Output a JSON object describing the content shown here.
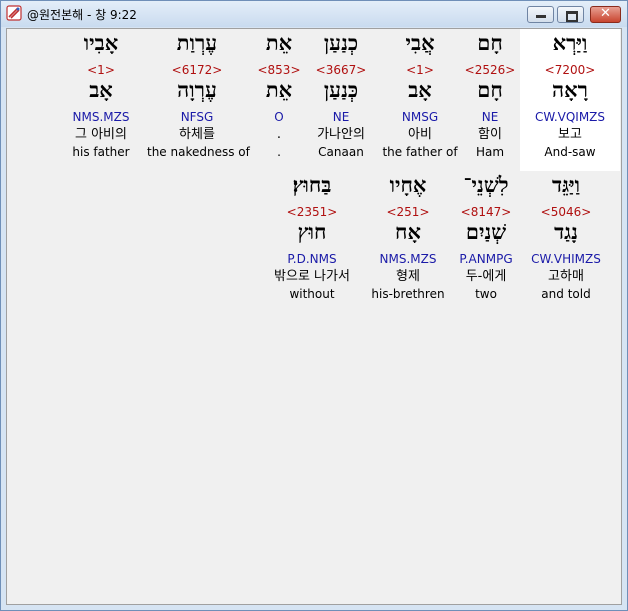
{
  "window": {
    "title": "@원전본해 - 창 9:22",
    "icon": "bible-app-icon",
    "controls": {
      "minimize": "minimize",
      "maximize": "maximize",
      "close": "✕"
    }
  },
  "colors": {
    "strong": "#b01010",
    "parse": "#1a1aa8",
    "highlight": "#ffffff"
  },
  "rows": [
    {
      "words": [
        {
          "heb": "וַיַּרְא",
          "strong": "<7200>",
          "lemma": "רָאָה",
          "parse": "CW.VQIMZS",
          "kor": "보고",
          "eng": "And-saw",
          "highlight": true
        },
        {
          "heb": "חָם",
          "strong": "<2526>",
          "lemma": "חָם",
          "parse": "NE",
          "kor": "함이",
          "eng": "Ham"
        },
        {
          "heb": "אֲבִי",
          "strong": "<1>",
          "lemma": "אָב",
          "parse": "NMSG",
          "kor": "아비",
          "eng": "the father of"
        },
        {
          "heb": "כְנַעַן",
          "strong": "<3667>",
          "lemma": "כְּנַעַן",
          "parse": "NE",
          "kor": "가나안의",
          "eng": "Canaan"
        },
        {
          "heb": "אֵת",
          "strong": "<853>",
          "lemma": "אֵת",
          "parse": "O",
          "kor": ".",
          "eng": "."
        },
        {
          "heb": "עֶרְוַת",
          "strong": "<6172>",
          "lemma": "עֶרְוָה",
          "parse": "NFSG",
          "kor": "하체를",
          "eng": "the nakedness of"
        },
        {
          "heb": "אָבִיו",
          "strong": "<1>",
          "lemma": "אָב",
          "parse": "NMS.MZS",
          "kor": "그 아비의",
          "eng": "his father"
        }
      ]
    },
    {
      "words": [
        {
          "heb": "וַיַּגֵּד",
          "strong": "<5046>",
          "lemma": "נָגַד",
          "parse": "CW.VHIMZS",
          "kor": "고하매",
          "eng": "and told"
        },
        {
          "heb": "לִשְׁנֵי־",
          "strong": "<8147>",
          "lemma": "שְׁנַיִם",
          "parse": "P.ANMPG",
          "kor": "두-에게",
          "eng": "two"
        },
        {
          "heb": "אֶחָיו",
          "strong": "<251>",
          "lemma": "אָח",
          "parse": "NMS.MZS",
          "kor": "형제",
          "eng": "his-brethren"
        },
        {
          "heb": "בַּחוּץ׃",
          "strong": "<2351>",
          "lemma": "חוּץ",
          "parse": "P.D.NMS",
          "kor": "밖으로 나가서",
          "eng": "without"
        }
      ]
    }
  ]
}
